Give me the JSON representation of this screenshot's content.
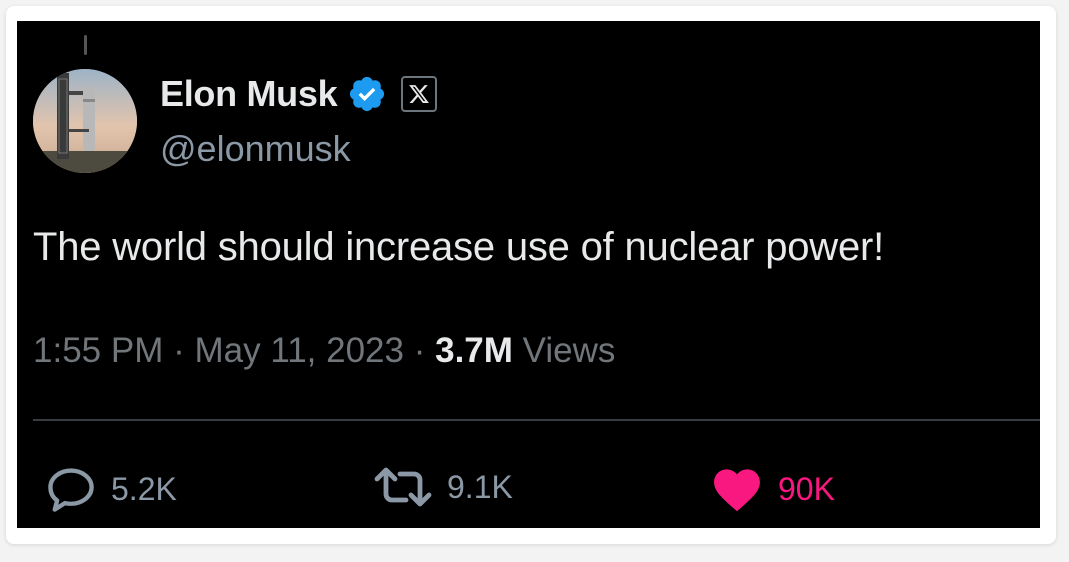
{
  "author": {
    "display_name": "Elon Musk",
    "handle": "@elonmusk",
    "verified_color": "#1d9bf0",
    "avatar_icon": "starship-tower-avatar"
  },
  "tweet": {
    "text": "The world should increase use of nuclear power!",
    "time": "1:55 PM",
    "separator": "·",
    "date": "May 11, 2023",
    "views_count": "3.7M",
    "views_label": "Views"
  },
  "actions": {
    "replies": "5.2K",
    "reposts": "9.1K",
    "likes": "90K",
    "like_color": "#f91880"
  }
}
